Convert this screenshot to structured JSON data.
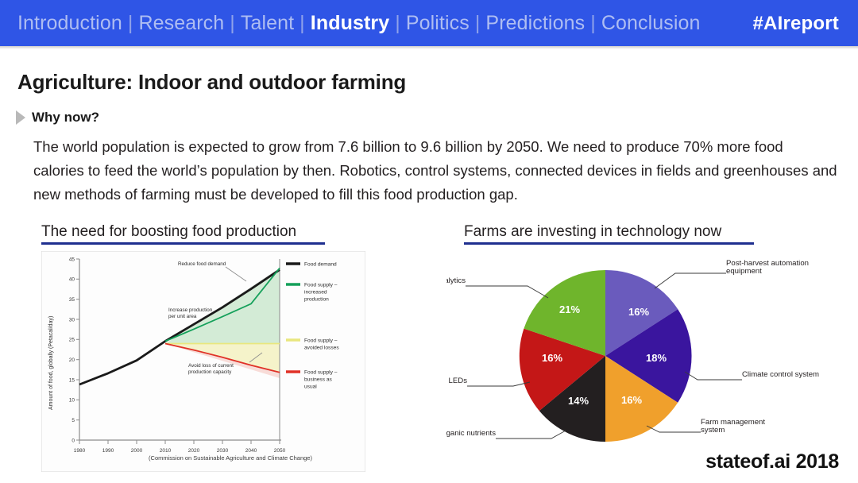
{
  "nav": {
    "items": [
      {
        "label": "Introduction",
        "active": false
      },
      {
        "label": "Research",
        "active": false
      },
      {
        "label": "Talent",
        "active": false
      },
      {
        "label": "Industry",
        "active": true
      },
      {
        "label": "Politics",
        "active": false
      },
      {
        "label": "Predictions",
        "active": false
      },
      {
        "label": "Conclusion",
        "active": false
      }
    ],
    "separator": "|",
    "hashtag": "#AIreport",
    "bar_color": "#2f55e6",
    "active_color": "#ffffff",
    "inactive_color": "#aebdf2"
  },
  "slide": {
    "title": "Agriculture: Indoor and outdoor farming",
    "bullet_label": "Why now?",
    "body": "The world population is expected to grow from 7.6 billion to 9.6 billion by 2050. We need to produce 70% more food calories to feed the world’s population by then. Robotics, control systems, connected devices in fields and greenhouses and new methods of farming must be developed to fill this food production gap.",
    "footer_brand": "stateof.ai 2018",
    "rule_color": "#1f2f8f"
  },
  "panels": {
    "left_heading": "The need for boosting food production",
    "right_heading": "Farms are investing in technology now"
  },
  "chart_data": [
    {
      "id": "food-production-line",
      "type": "line",
      "title": "The need for boosting food production",
      "xlabel": "",
      "ylabel": "Amount of food, globally (Petacal/day)",
      "caption": "(Commission on Sustainable Agriculture and Climate Change)",
      "xlim": [
        1980,
        2050
      ],
      "ylim": [
        0,
        45
      ],
      "xticks": [
        1980,
        1990,
        2000,
        2010,
        2020,
        2030,
        2040,
        2050
      ],
      "yticks": [
        0,
        5,
        10,
        15,
        20,
        25,
        30,
        35,
        40,
        45
      ],
      "grid": false,
      "legend_position": "right",
      "series": [
        {
          "name": "Food demand",
          "color": "#1a1a1a",
          "x": [
            1980,
            1990,
            2000,
            2010,
            2020,
            2030,
            2040,
            2050
          ],
          "values": [
            13.8,
            16.6,
            19.8,
            24.6,
            28.8,
            33.0,
            37.6,
            42.3
          ]
        },
        {
          "name": "Food supply – increased production",
          "color": "#14a05a",
          "x": [
            2010,
            2020,
            2030,
            2040,
            2050
          ],
          "values": [
            24.6,
            27.6,
            30.7,
            33.9,
            37.2
          ]
        },
        {
          "name": "Food supply – avoided losses",
          "color": "#f2f08a",
          "x": [
            2010,
            2020,
            2030,
            2040,
            2050
          ],
          "values": [
            24.6,
            24.6,
            24.6,
            24.6,
            24.6
          ]
        },
        {
          "name": "Food supply – business as usual",
          "color": "#e03127",
          "x": [
            2010,
            2020,
            2030,
            2040,
            2050
          ],
          "values": [
            24.6,
            23.0,
            21.2,
            19.2,
            17.0
          ]
        }
      ],
      "annotations": [
        {
          "text": "Reduce food demand"
        },
        {
          "text": "Increase production per unit area"
        },
        {
          "text": "Avoid loss of current production capacity"
        }
      ]
    },
    {
      "id": "farm-technology-pie",
      "type": "pie",
      "title": "Farms are investing in technology now",
      "legend_position": "callouts",
      "labels": [
        "Post-harvest automation equipment",
        "Climate control system",
        "Farm management system",
        "Organic nutrients",
        "Adding LEDs",
        "Data and analytics"
      ],
      "values": [
        16,
        18,
        16,
        14,
        16,
        21
      ],
      "value_labels": [
        "16%",
        "18%",
        "16%",
        "14%",
        "16%",
        "21%"
      ],
      "colors": [
        "#6a5bbd",
        "#3a159e",
        "#f0a02c",
        "#231f20",
        "#c41717",
        "#6fb52c"
      ]
    }
  ]
}
